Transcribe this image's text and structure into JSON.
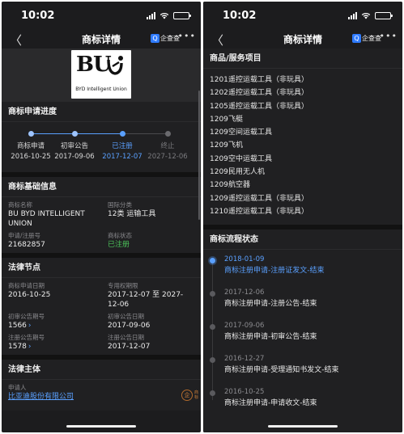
{
  "status_bar": {
    "time": "10:02"
  },
  "nav": {
    "title": "商标详情",
    "qcc_badge": "Q",
    "qcc_label": "企查查",
    "more": "•••"
  },
  "logo": {
    "main": "BU",
    "sub": "BYD Intelligent Union"
  },
  "progress": {
    "title": "商标申请进度",
    "steps": [
      {
        "label": "商标申请",
        "date": "2016-10-25",
        "state": "done"
      },
      {
        "label": "初审公告",
        "date": "2017-09-06",
        "state": "done"
      },
      {
        "label": "已注册",
        "date": "2017-12-07",
        "state": "current"
      },
      {
        "label": "终止",
        "date": "2027-12-06",
        "state": "future"
      }
    ]
  },
  "basic": {
    "title": "商标基础信息",
    "name_label": "商标名称",
    "name_value": "BU BYD INTELLIGENT UNION",
    "class_label": "国际分类",
    "class_value": "12类 运输工具",
    "regno_label": "申请/注册号",
    "regno_value": "21682857",
    "status_label": "商标状态",
    "status_value": "已注册"
  },
  "legal": {
    "title": "法律节点",
    "apply_date_label": "商标申请日期",
    "apply_date_value": "2016-10-25",
    "period_label": "专用权期限",
    "period_value": "2017-12-07 至 2027-12-06",
    "prelim_issue_label": "初审公告期号",
    "prelim_issue_value": "1566",
    "prelim_date_label": "初审公告日期",
    "prelim_date_value": "2017-09-06",
    "reg_issue_label": "注册公告期号",
    "reg_issue_value": "1578",
    "reg_date_label": "注册公告日期",
    "reg_date_value": "2017-12-07"
  },
  "subject": {
    "title": "法律主体",
    "applicant_label": "申请人",
    "applicant_value": "比亚迪股份有限公司",
    "seal_mark": "企",
    "seal_text": "商标"
  },
  "goods": {
    "title": "商品/服务项目",
    "items": [
      {
        "code": "1201",
        "name": "遥控运载工具（非玩具）"
      },
      {
        "code": "1202",
        "name": "遥控运载工具（非玩具）"
      },
      {
        "code": "1205",
        "name": "遥控运载工具（非玩具）"
      },
      {
        "code": "1209",
        "name": "飞艇"
      },
      {
        "code": "1209",
        "name": "空间运载工具"
      },
      {
        "code": "1209",
        "name": "飞机"
      },
      {
        "code": "1209",
        "name": "空中运载工具"
      },
      {
        "code": "1209",
        "name": "民用无人机"
      },
      {
        "code": "1209",
        "name": "航空器"
      },
      {
        "code": "1209",
        "name": "遥控运载工具（非玩具）"
      },
      {
        "code": "1210",
        "name": "遥控运载工具（非玩具）"
      }
    ]
  },
  "flow": {
    "title": "商标流程状态",
    "items": [
      {
        "date": "2018-01-09",
        "text": "商标注册申请-注册证发文-结束",
        "current": true
      },
      {
        "date": "2017-12-06",
        "text": "商标注册申请-注册公告-结束",
        "current": false
      },
      {
        "date": "2017-09-06",
        "text": "商标注册申请-初审公告-结束",
        "current": false
      },
      {
        "date": "2016-12-27",
        "text": "商标注册申请-受理通知书发文-结束",
        "current": false
      },
      {
        "date": "2016-10-25",
        "text": "商标注册申请-申请收文-结束",
        "current": false
      }
    ]
  },
  "colors": {
    "accent": "#5aa0ff",
    "green": "#4cc35a",
    "bg": "#1c1c1e"
  }
}
